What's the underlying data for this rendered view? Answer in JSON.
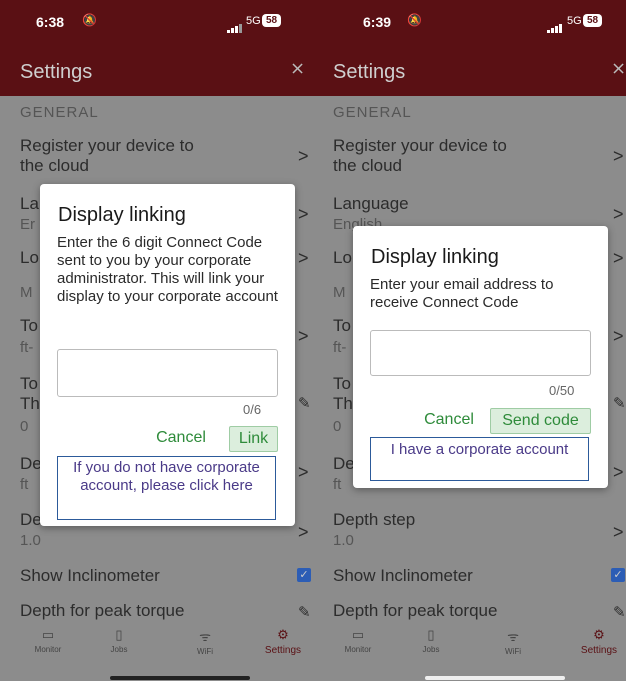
{
  "left": {
    "status": {
      "time": "6:38",
      "network": "5G",
      "battery": "58"
    },
    "appbar": {
      "title": "Settings"
    },
    "section_general": "GENERAL",
    "rows": {
      "register_title": "Register your device to",
      "register_title2": "the cloud",
      "lang_partial": "La",
      "lang_sub_partial": "Er",
      "lo_partial": "Lo",
      "m_partial": "M",
      "to1_partial": "To",
      "ft_partial": "ft-",
      "to2_partial": "To",
      "th_partial": "Th",
      "zero_partial": "0",
      "de_partial": "De",
      "ft2_partial": "ft",
      "dep_partial": "De",
      "dep_sub": "1.0",
      "show_inclinometer": "Show Inclinometer",
      "depth_peak": "Depth for peak torque"
    },
    "dialog": {
      "title": "Display linking",
      "message": "Enter the 6 digit Connect Code sent to you by your corporate administrator. This will link your display to your corporate account",
      "input_value": "",
      "counter": "0/6",
      "cancel": "Cancel",
      "primary": "Link",
      "corporate_link": "If you do not have corporate account, please click here"
    },
    "nav": {
      "monitor": "Monitor",
      "jobs": "Jobs",
      "wifi": "WiFi",
      "settings": "Settings"
    }
  },
  "right": {
    "status": {
      "time": "6:39",
      "network": "5G",
      "battery": "58"
    },
    "appbar": {
      "title": "Settings"
    },
    "section_general": "GENERAL",
    "rows": {
      "register_title": "Register your device to",
      "register_title2": "the cloud",
      "language": "Language",
      "language_sub": "English",
      "lo_partial": "Lo",
      "m_partial": "M",
      "to1_partial": "To",
      "ft_partial": "ft-",
      "to2_partial": "To",
      "th_partial": "Th",
      "zero_partial": "0",
      "de_partial": "De",
      "ft2_partial": "ft",
      "depth_step": "Depth step",
      "depth_step_sub": "1.0",
      "show_inclinometer": "Show Inclinometer",
      "depth_peak": "Depth for peak torque"
    },
    "dialog": {
      "title": "Display linking",
      "message": "Enter your email address to receive Connect Code",
      "input_value": "",
      "counter": "0/50",
      "cancel": "Cancel",
      "primary": "Send code",
      "corporate_link": "I have a corporate account"
    },
    "nav": {
      "monitor": "Monitor",
      "jobs": "Jobs",
      "wifi": "WiFi",
      "settings": "Settings"
    }
  },
  "colors": {
    "appbar": "#5a1014",
    "link_green": "#2e8b3a",
    "checkbox": "#2c5db5"
  }
}
